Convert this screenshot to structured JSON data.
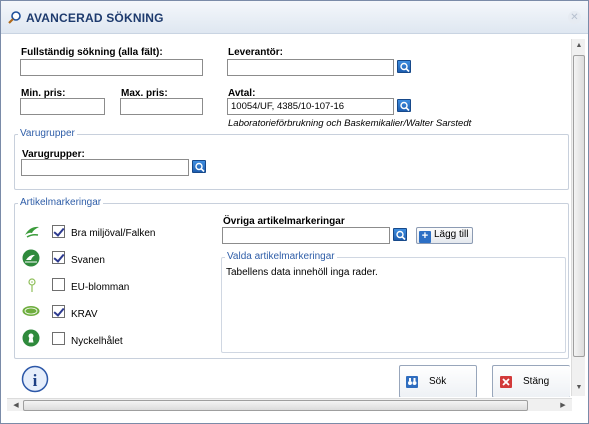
{
  "window": {
    "title": "AVANCERAD SÖKNING"
  },
  "fields": {
    "full_search_label": "Fullständig sökning (alla fält):",
    "full_search_value": "",
    "supplier_label": "Leverantör:",
    "supplier_value": "",
    "min_price_label": "Min. pris:",
    "min_price_value": "",
    "max_price_label": "Max. pris:",
    "max_price_value": "",
    "agreement_label": "Avtal:",
    "agreement_value": "10054/UF, 4385/10-107-16",
    "agreement_note": "Laboratorieförbrukning och Baskemikalier/Walter Sarstedt"
  },
  "product_groups": {
    "legend": "Varugrupper",
    "label": "Varugrupper:",
    "value": ""
  },
  "markings": {
    "legend": "Artikelmarkeringar",
    "items": [
      {
        "label": "Bra miljöval/Falken",
        "checked": true,
        "icon": "falken-icon"
      },
      {
        "label": "Svanen",
        "checked": true,
        "icon": "svanen-icon"
      },
      {
        "label": "EU-blomman",
        "checked": false,
        "icon": "eu-flower-icon"
      },
      {
        "label": "KRAV",
        "checked": true,
        "icon": "krav-icon"
      },
      {
        "label": "Nyckelhålet",
        "checked": false,
        "icon": "keyhole-icon"
      }
    ],
    "other_label": "Övriga artikelmarkeringar",
    "other_value": "",
    "add_button": "Lägg till",
    "selected_legend": "Valda artikelmarkeringar",
    "selected_empty": "Tabellens data innehöll inga rader."
  },
  "buttons": {
    "search": "Sök",
    "close": "Stäng"
  },
  "colors": {
    "accent": "#2f5ea8",
    "title": "#1e3b6e",
    "lookup": "#2c6fc5"
  }
}
